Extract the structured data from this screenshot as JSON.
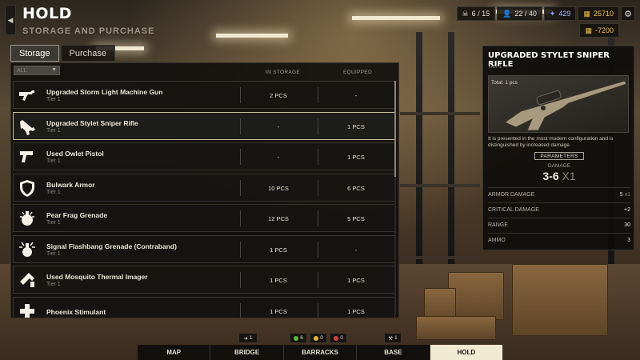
{
  "header": {
    "title": "HOLD",
    "subtitle": "STORAGE AND PURCHASE",
    "back_icon": "chevron-left-icon"
  },
  "resources": [
    {
      "icon": "skull-icon",
      "value": "6 / 15",
      "color": "#e6e0d2"
    },
    {
      "icon": "person-icon",
      "value": "22 / 40",
      "color": "#e6e0d2"
    },
    {
      "icon": "crystal-icon",
      "value": "429",
      "color": "#8a9cff"
    },
    {
      "icon": "coin-icon",
      "value": "25710",
      "color": "#f3c044"
    }
  ],
  "balance_change": "-7200",
  "tabs": [
    {
      "label": "Storage",
      "active": true
    },
    {
      "label": "Purchase",
      "active": false
    }
  ],
  "list": {
    "filter_value": "ALL",
    "columns": {
      "in_storage": "IN STORAGE",
      "equipped": "EQUIPPED"
    },
    "items": [
      {
        "name": "Upgraded Storm Light Machine Gun",
        "tier": "Tier 1",
        "storage": "2 PCS",
        "equipped": "-",
        "icon": "machine-gun-icon",
        "selected": false
      },
      {
        "name": "Upgraded Stylet Sniper Rifle",
        "tier": "Tier 1",
        "storage": "-",
        "equipped": "1 PCS",
        "icon": "sniper-rifle-icon",
        "selected": true
      },
      {
        "name": "Used Owlet Pistol",
        "tier": "Tier 1",
        "storage": "-",
        "equipped": "1 PCS",
        "icon": "pistol-icon",
        "selected": false
      },
      {
        "name": "Bulwark Armor",
        "tier": "Tier 1",
        "storage": "10 PCS",
        "equipped": "6 PCS",
        "icon": "armor-shield-icon",
        "selected": false
      },
      {
        "name": "Pear Frag Grenade",
        "tier": "Tier 1",
        "storage": "12 PCS",
        "equipped": "5 PCS",
        "icon": "frag-grenade-icon",
        "selected": false
      },
      {
        "name": "Signal Flashbang Grenade (Contraband)",
        "tier": "Tier 1",
        "storage": "1 PCS",
        "equipped": "-",
        "icon": "flashbang-icon",
        "selected": false
      },
      {
        "name": "Used Mosquito Thermal Imager",
        "tier": "Tier 1",
        "storage": "1 PCS",
        "equipped": "1 PCS",
        "icon": "thermal-imager-icon",
        "selected": false
      },
      {
        "name": "Phoenix Stimulant",
        "tier": "",
        "storage": "1 PCS",
        "equipped": "1 PCS",
        "icon": "medkit-icon",
        "selected": false
      }
    ]
  },
  "details": {
    "title": "UPGRADED STYLET SNIPER RIFLE",
    "tier": "Tier 1",
    "total": "Total: 1 pcs",
    "description": "It is presented in the most modern configuration and is distinguished by increased damage.",
    "params_label": "PARAMETERS",
    "damage_label": "DAMAGE",
    "damage_value": "3-6",
    "damage_mult": "X1",
    "stats": [
      {
        "label": "ARMOR DAMAGE",
        "value": "5",
        "suffix": "x1"
      },
      {
        "label": "CRITICAL DAMAGE",
        "value": "+2",
        "suffix": ""
      },
      {
        "label": "RANGE",
        "value": "30",
        "suffix": ""
      },
      {
        "label": "AMMO",
        "value": "3",
        "suffix": ""
      }
    ]
  },
  "bottom_badges": {
    "map_badge": "1",
    "base_badge": "1",
    "green": "6",
    "yellow": "0",
    "red": "0"
  },
  "nav": [
    {
      "label": "MAP",
      "active": false
    },
    {
      "label": "BRIDGE",
      "active": false
    },
    {
      "label": "BARRACKS",
      "active": false
    },
    {
      "label": "BASE",
      "active": false
    },
    {
      "label": "HOLD",
      "active": true
    }
  ]
}
